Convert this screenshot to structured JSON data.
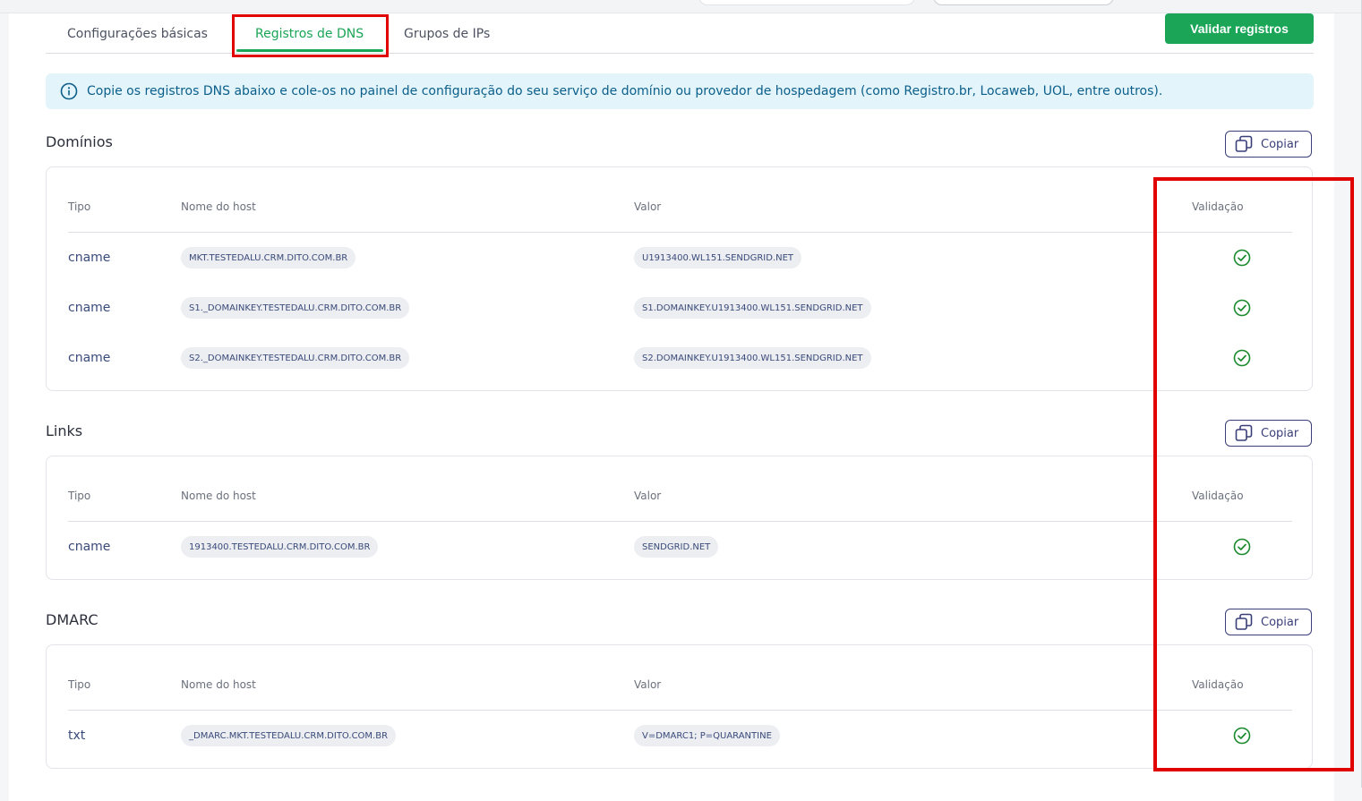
{
  "tabs": [
    {
      "label": "Configurações básicas"
    },
    {
      "label": "Registros de DNS"
    },
    {
      "label": "Grupos de IPs"
    }
  ],
  "validate_button": "Validar registros",
  "info_banner": "Copie os registros DNS abaixo e cole-os no painel de configuração do seu serviço de domínio ou provedor de hospedagem (como Registro.br, Locaweb, UOL, entre outros).",
  "copy_label": "Copiar",
  "columns": {
    "type": "Tipo",
    "host": "Nome do host",
    "value": "Valor",
    "validation": "Validação"
  },
  "sections": [
    {
      "title": "Domínios",
      "rows": [
        {
          "type": "cname",
          "host": "MKT.TESTEDALU.CRM.DITO.COM.BR",
          "value": "U1913400.WL151.SENDGRID.NET",
          "validated": true
        },
        {
          "type": "cname",
          "host": "S1._DOMAINKEY.TESTEDALU.CRM.DITO.COM.BR",
          "value": "S1.DOMAINKEY.U1913400.WL151.SENDGRID.NET",
          "validated": true
        },
        {
          "type": "cname",
          "host": "S2._DOMAINKEY.TESTEDALU.CRM.DITO.COM.BR",
          "value": "S2.DOMAINKEY.U1913400.WL151.SENDGRID.NET",
          "validated": true
        }
      ]
    },
    {
      "title": "Links",
      "rows": [
        {
          "type": "cname",
          "host": "1913400.TESTEDALU.CRM.DITO.COM.BR",
          "value": "SENDGRID.NET",
          "validated": true
        }
      ]
    },
    {
      "title": "DMARC",
      "rows": [
        {
          "type": "txt",
          "host": "_DMARC.MKT.TESTEDALU.CRM.DITO.COM.BR",
          "value": "V=DMARC1; P=QUARANTINE",
          "validated": true
        }
      ]
    }
  ],
  "colors": {
    "accent_green": "#1aa557",
    "navy": "#3a3f7a",
    "info_bg": "#e3f4fb",
    "info_text": "#0b5f8a",
    "highlight_red": "#e10000"
  },
  "icons": {
    "info": "info-circle-icon",
    "copy": "copy-icon",
    "validated": "check-circle-icon"
  }
}
